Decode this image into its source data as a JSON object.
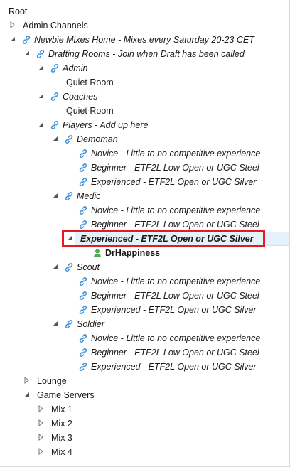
{
  "root": "Root",
  "admin_channels": "Admin Channels",
  "newbie_home": "Newbie Mixes Home - Mixes every Saturday 20-23 CET",
  "drafting_rooms": "Drafting Rooms - Join when Draft has been called",
  "admin": "Admin",
  "quiet_room_1": "Quiet Room",
  "coaches": "Coaches",
  "quiet_room_2": "Quiet Room",
  "players": "Players - Add up here",
  "demoman": {
    "label": "Demoman",
    "novice": "Novice - Little to no competitive experience",
    "beginner": "Beginner - ETF2L Low Open or UGC Steel",
    "experienced": "Experienced - ETF2L Open or UGC Silver"
  },
  "medic": {
    "label": "Medic",
    "novice": "Novice - Little to no competitive experience",
    "beginner": "Beginner - ETF2L Low Open or UGC Steel",
    "experienced": "Experienced - ETF2L Open or UGC Silver"
  },
  "medic_user": "DrHappiness",
  "scout": {
    "label": "Scout",
    "novice": "Novice - Little to no competitive experience",
    "beginner": "Beginner - ETF2L Low Open or UGC Steel",
    "experienced": "Experienced - ETF2L Open or UGC Silver"
  },
  "soldier": {
    "label": "Soldier",
    "novice": "Novice - Little to no competitive experience",
    "beginner": "Beginner - ETF2L Low Open or UGC Steel",
    "experienced": "Experienced - ETF2L Open or UGC Silver"
  },
  "lounge": "Lounge",
  "game_servers": "Game Servers",
  "mix1": "Mix 1",
  "mix2": "Mix 2",
  "mix3": "Mix 3",
  "mix4": "Mix 4",
  "colors": {
    "link_icon": "#3a8fd9",
    "selection": "#e5f1fb",
    "highlight_box": "#e01b24",
    "user_icon": "#4caf50"
  }
}
